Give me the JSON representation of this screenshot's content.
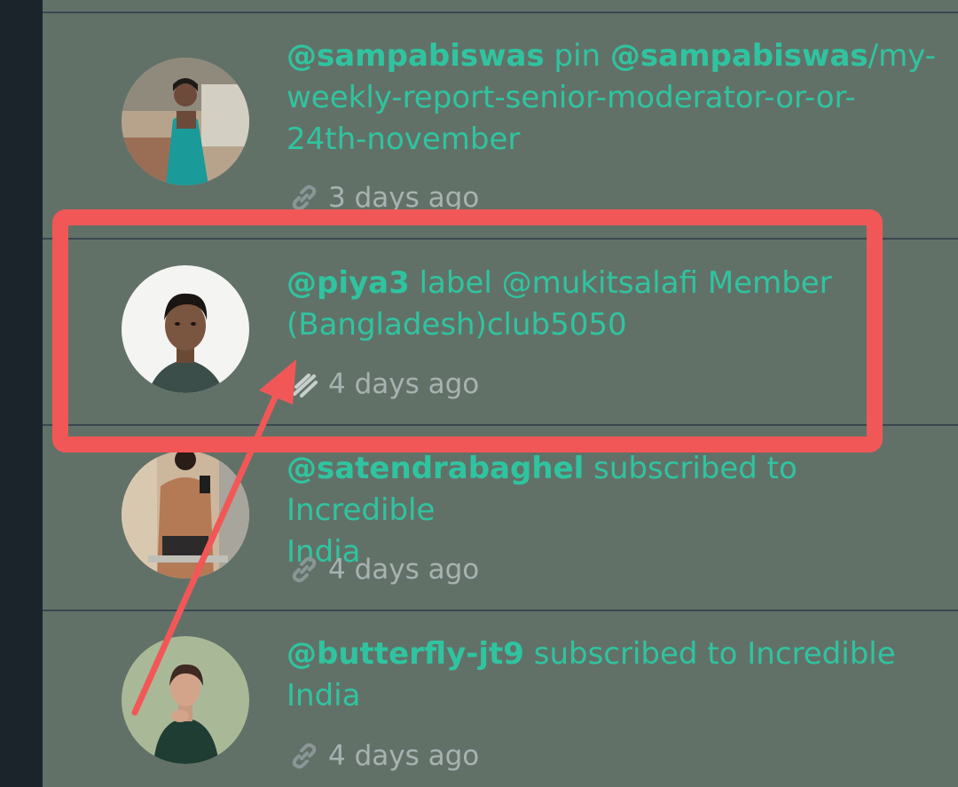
{
  "feed": {
    "items": [
      {
        "user": "@sampabiswas",
        "action": "pin",
        "target_user": "@sampabiswas",
        "target_rest": "/my-weekly-report-senior-moderator-or-or-24th-november",
        "line1_rest": "/my-",
        "line2": "weekly-report-senior-moderator-or-or-",
        "line3": "24th-november",
        "time": "3 days ago",
        "icon": "link-icon"
      },
      {
        "user": "@piya3",
        "action": "label",
        "line1_rest": "@mukitsalafi Member",
        "line2": "(Bangladesh)club5050",
        "time": "4 days ago",
        "icon": "label-icon"
      },
      {
        "user": "@satendrabaghel",
        "action": "subscribed to Incredible",
        "line2": "India",
        "time": "4 days ago",
        "icon": "link-icon"
      },
      {
        "user": "@butterfly-jt9",
        "action": "subscribed to Incredible",
        "line2": "India",
        "time": "4 days ago",
        "icon": "link-icon"
      }
    ]
  },
  "annotation": {
    "highlight_color": "#f25757",
    "target": "@piya3 label activity"
  }
}
